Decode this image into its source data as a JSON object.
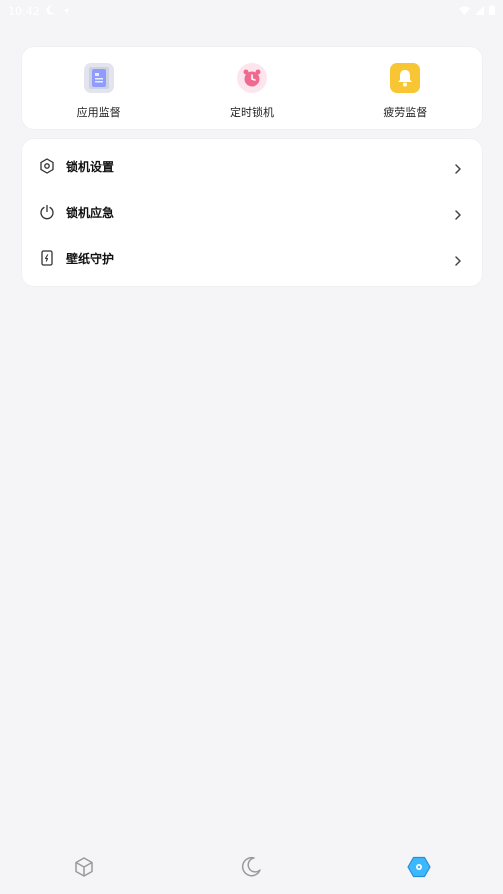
{
  "status_bar": {
    "time": "10:42"
  },
  "quick_actions": [
    {
      "label": "应用监督",
      "icon": "app-doc-icon",
      "color": "#8f9bff"
    },
    {
      "label": "定时锁机",
      "icon": "alarm-clock-icon",
      "color": "#f06a8f"
    },
    {
      "label": "疲劳监督",
      "icon": "bell-icon",
      "color": "#f8c534"
    }
  ],
  "menu": [
    {
      "label": "锁机设置",
      "icon": "hexagon-gear-icon"
    },
    {
      "label": "锁机应急",
      "icon": "power-icon"
    },
    {
      "label": "壁纸守护",
      "icon": "phone-charge-icon"
    }
  ],
  "bottom_nav": [
    {
      "icon": "cube-icon"
    },
    {
      "icon": "moon-icon"
    },
    {
      "icon": "hexagon-settings-icon",
      "active": true,
      "color": "#3cb8ff"
    }
  ]
}
